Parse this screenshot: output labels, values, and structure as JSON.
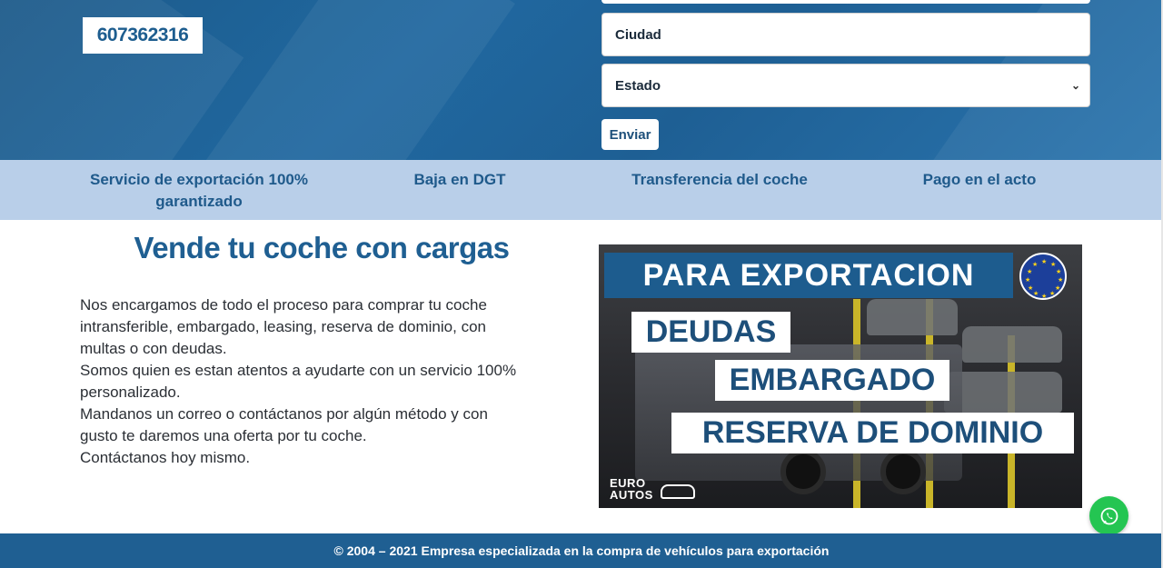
{
  "hero": {
    "phone": "607362316",
    "city_placeholder": "Ciudad",
    "state_select": "Estado",
    "send_label": "Enviar"
  },
  "features": [
    {
      "line1": "Servicio de exportación 100%",
      "line2": "garantizado"
    },
    {
      "line1": "Baja en DGT",
      "line2": ""
    },
    {
      "line1": "Transferencia del coche",
      "line2": ""
    },
    {
      "line1": "Pago en el acto",
      "line2": ""
    }
  ],
  "content": {
    "title": "Vende tu coche con cargas",
    "paragraph_lines": [
      "Nos encargamos de todo el proceso para comprar tu coche",
      "intransferible, embargado, leasing, reserva de dominio, con",
      "multas o con deudas.",
      "Somos quien es estan atentos a ayudarte con un servicio 100%",
      "personalizado.",
      "Mandanos un correo o contáctanos por algún método y con",
      "gusto te daremos una oferta por tu coche.",
      "Contáctanos hoy mismo."
    ]
  },
  "banner": {
    "heading": "PARA EXPORTACION",
    "tags": [
      "DEUDAS",
      "EMBARGADO",
      "RESERVA DE DOMINIO"
    ],
    "logo_line1": "EURO",
    "logo_line2": "AUTOS"
  },
  "footer": {
    "text": "© 2004 – 2021 Empresa especializada en la compra de vehículos para exportación"
  },
  "colors": {
    "primary": "#1f5f92",
    "feature_bar": "#b9cfe9",
    "whatsapp": "#24c552"
  }
}
